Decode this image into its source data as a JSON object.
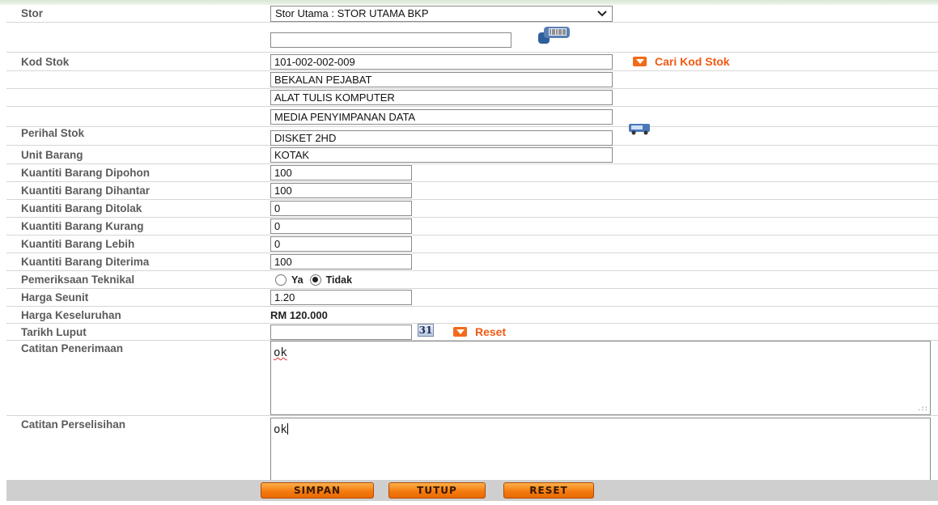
{
  "form": {
    "stor": {
      "label": "Stor",
      "selected": "Stor Utama : STOR UTAMA BKP"
    },
    "barcode_input": {
      "value": ""
    },
    "kod_stok": {
      "label": "Kod Stok",
      "value": "101-002-002-009",
      "search_link": "Cari Kod Stok"
    },
    "kategori": [
      "BEKALAN PEJABAT",
      "ALAT TULIS KOMPUTER",
      "MEDIA PENYIMPANAN DATA"
    ],
    "perihal_stok": {
      "label": "Perihal Stok",
      "value": "DISKET 2HD"
    },
    "unit_barang": {
      "label": "Unit Barang",
      "value": "KOTAK"
    },
    "kuantiti": [
      {
        "label": "Kuantiti Barang Dipohon",
        "value": "100"
      },
      {
        "label": "Kuantiti Barang Dihantar",
        "value": "100"
      },
      {
        "label": "Kuantiti Barang Ditolak",
        "value": "0"
      },
      {
        "label": "Kuantiti Barang Kurang",
        "value": "0"
      },
      {
        "label": "Kuantiti Barang Lebih",
        "value": "0"
      },
      {
        "label": "Kuantiti Barang Diterima",
        "value": "100"
      }
    ],
    "pemeriksaan": {
      "label": "Pemeriksaan Teknikal",
      "option_ya": "Ya",
      "option_tidak": "Tidak",
      "selected": "Tidak"
    },
    "harga_seunit": {
      "label": "Harga Seunit",
      "value": "1.20"
    },
    "harga_keseluruhan": {
      "label": "Harga Keseluruhan",
      "value": "RM 120.000"
    },
    "tarikh_luput": {
      "label": "Tarikh Luput",
      "value": "",
      "calendar_text": "31",
      "reset_link": "Reset"
    },
    "catitan_penerimaan": {
      "label": "Catitan Penerimaan",
      "value": "ok"
    },
    "catitan_perselisihan": {
      "label": "Catitan Perselisihan",
      "value": "ok"
    }
  },
  "buttons": {
    "simpan": "SIMPAN",
    "tutup": "TUTUP",
    "reset": "RESET"
  },
  "colors": {
    "accent_orange": "#f26a1b",
    "label_gray": "#5b5b5b",
    "button_bar": "#cfcfcf"
  }
}
